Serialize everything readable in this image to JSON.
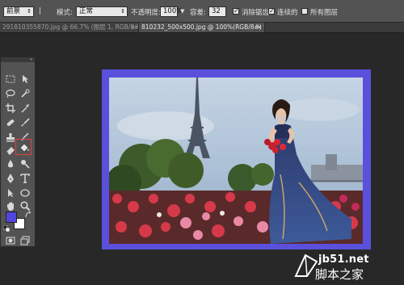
{
  "options_bar": {
    "fill_source": "前景",
    "mode_label": "模式:",
    "mode_value": "正常",
    "opacity_label": "不透明度:",
    "opacity_value": "100%",
    "tolerance_label": "容差:",
    "tolerance_value": "32",
    "antialias_label": "消除锯齿",
    "antialias_checked": true,
    "contiguous_label": "连续的",
    "contiguous_checked": true,
    "all_layers_label": "所有图层",
    "all_layers_checked": false
  },
  "tabs": [
    {
      "label": "291810355870.jpg @ 66.7% (图层 1, RGB/8#) *",
      "close": "×",
      "active": false
    },
    {
      "label": "810232_500x500.jpg @ 100%(RGB/8#) *",
      "close": "×",
      "active": true
    }
  ],
  "toolbox": {
    "collapse": "«",
    "active_tool": "paint-bucket",
    "foreground_color": "#5145df",
    "background_color": "#ffffff"
  },
  "canvas": {
    "fill_color": "#5a50dc"
  },
  "watermark": {
    "line1": "jb51.net",
    "line2": "脚本之家"
  }
}
